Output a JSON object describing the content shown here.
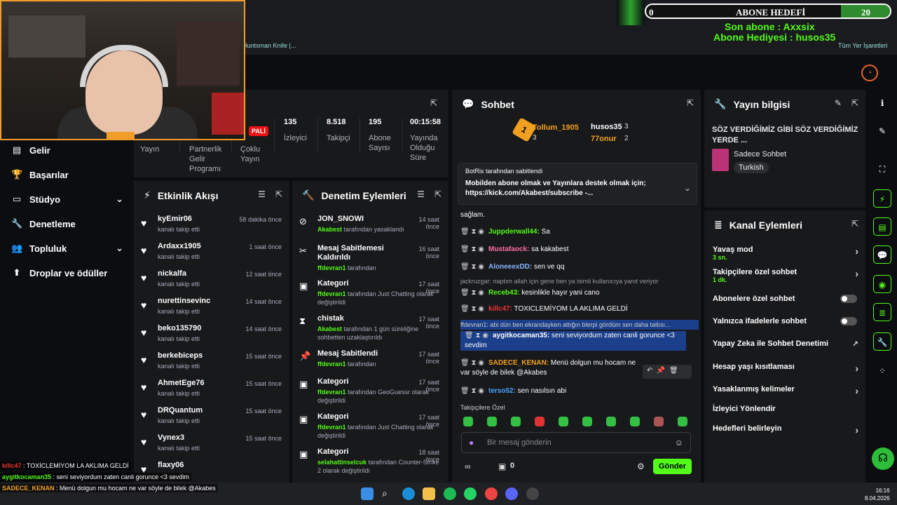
{
  "overlay": {
    "goal_left": "0",
    "goal_title": "ABONE HEDEFİ",
    "goal_value": "20",
    "last_sub": "Son abone : Axxsix",
    "gifter": "Abone Hediyesi : husos35"
  },
  "browser": {
    "bookmark_left": "Huntsman Knife |...",
    "bookmark_right": "Tüm Yer İşaretleri"
  },
  "sidebar": {
    "items": [
      {
        "label": "Gelir"
      },
      {
        "label": "Başarılar"
      },
      {
        "label": "Stüdyo"
      },
      {
        "label": "Denetleme"
      },
      {
        "label": "Topluluk"
      },
      {
        "label": "Droplar ve ödüller"
      }
    ]
  },
  "stats": {
    "badge": "PALİ",
    "cols": [
      {
        "value": "",
        "label": "Yayın"
      },
      {
        "value": "",
        "label": "Partnerlik Gelir Programı"
      },
      {
        "value": "",
        "label": "Çoklu Yayın"
      },
      {
        "value": "135",
        "label": "İzleyici"
      },
      {
        "value": "8.518",
        "label": "Takipçi"
      },
      {
        "value": "195",
        "label": "Abone Sayısı"
      },
      {
        "value": "00:15:58",
        "label": "Yayında Olduğu Süre"
      }
    ]
  },
  "activity": {
    "title": "Etkinlik Akışı",
    "items": [
      {
        "name": "kyEmir06",
        "sub": "kanalı takip etti",
        "time": "58 dakika önce"
      },
      {
        "name": "Ardaxx1905",
        "sub": "kanalı takip etti",
        "time": "1 saat önce"
      },
      {
        "name": "nickalfa",
        "sub": "kanalı takip etti",
        "time": "12 saat önce"
      },
      {
        "name": "nurettinsevinc",
        "sub": "kanalı takip etti",
        "time": "14 saat önce"
      },
      {
        "name": "beko135790",
        "sub": "kanalı takip etti",
        "time": "14 saat önce"
      },
      {
        "name": "berkebiceps",
        "sub": "kanalı takip etti",
        "time": "15 saat önce"
      },
      {
        "name": "AhmetEge76",
        "sub": "kanalı takip etti",
        "time": "15 saat önce"
      },
      {
        "name": "DRQuantum",
        "sub": "kanalı takip etti",
        "time": "15 saat önce"
      },
      {
        "name": "Vynex3",
        "sub": "kanalı takip etti",
        "time": "15 saat önce"
      },
      {
        "name": "flaxy06",
        "sub": "",
        "time": ""
      }
    ]
  },
  "moderation": {
    "title": "Denetim Eylemleri",
    "items": [
      {
        "title": "JON_SNOWI",
        "time": "14 saat önce",
        "actor": "Akabest",
        "desc": " tarafından yasaklandı"
      },
      {
        "title": "Mesaj Sabitlemesi Kaldırıldı",
        "time": "16 saat önce",
        "actor": "ffdevran1",
        "desc": " tarafından"
      },
      {
        "title": "Kategori",
        "time": "17 saat önce",
        "actor": "ffdevran1",
        "desc": " tarafından Just Chatting olarak değiştirildi"
      },
      {
        "title": "chistak",
        "time": "17 saat önce",
        "actor": "Akabest",
        "desc": " tarafından 1 gün süreliğine sohbetten uzaklaştırıldı"
      },
      {
        "title": "Mesaj Sabitlendi",
        "time": "17 saat önce",
        "actor": "ffdevran1",
        "desc": " tarafından"
      },
      {
        "title": "Kategori",
        "time": "17 saat önce",
        "actor": "ffdevran1",
        "desc": " tarafından GeoGuessr olarak değiştirildi"
      },
      {
        "title": "Kategori",
        "time": "17 saat önce",
        "actor": "ffdevran1",
        "desc": " tarafından Just Chatting olarak değiştirildi"
      },
      {
        "title": "Kategori",
        "time": "18 saat önce",
        "actor": "selahattinselcuk",
        "desc": " tarafından Counter-Strike 2 olarak değiştirildi"
      }
    ]
  },
  "chat": {
    "title": "Sohbet",
    "leader1": "Tollum_1905",
    "leader1_val": "3",
    "leader2": "husos35",
    "leader2_val": "3",
    "leader3": "77onur",
    "leader3_val": "2",
    "pinned_by": "BotRix tarafından sabitlendi",
    "pinned_text": "Mobilden abone olmak ve Yayınlara destek olmak için; https://kick.com/Akabest/subscribe -...",
    "messages": [
      {
        "user": "",
        "text": "sağlam."
      },
      {
        "user": "Juppderwall44:",
        "text": " Sa"
      },
      {
        "user": "Mustafaock:",
        "text": " sa kakabest"
      },
      {
        "user": "AloneeexDD:",
        "text": " sen ve qq"
      },
      {
        "user": "",
        "text": "jackruzgar: naptım allah için gene ben ya isimli kullanıcıya yanıt veriyor"
      },
      {
        "user": "Receb43:",
        "text": " kesinlikle hayır yani cano"
      },
      {
        "user": "killc47:",
        "text": " TOXICLEMİYOM LA AKLIMA GELDİ"
      },
      {
        "user": "",
        "text": "ffdevran1: abi dün ben ekrandayken attığın blerpi gördüm sen daha tatlısı..."
      },
      {
        "user": "aygitkocaman35:",
        "text": " seni seviyordum zaten canli gorunce <3 sevdim"
      },
      {
        "user": "SADECE_KENAN:",
        "text": " Menü dolgun mu hocam ne var söyle de bilek @Akabes"
      },
      {
        "user": "terso52:",
        "text": " sen nasılsın abi"
      }
    ],
    "followers_only": "Takipçilere Özel",
    "placeholder": "Bir mesaj gönderin",
    "bottom_count": "0",
    "send": "Gönder"
  },
  "stream_info": {
    "title": "Yayın bilgisi",
    "stream_title": "SÖZ VERDİĞİMİZ GİBİ SÖZ VERDİĞİMİZ YERDE ...",
    "category": "Sadece Sohbet",
    "language": "Turkish"
  },
  "channel_actions": {
    "title": "Kanal Eylemleri",
    "rows": [
      {
        "label": "Yavaş mod",
        "sub": "3 sn."
      },
      {
        "label": "Takipçilere özel sohbet",
        "sub": "1 dk."
      },
      {
        "label": "Abonelere özel sohbet",
        "sub": ""
      },
      {
        "label": "Yalnızca ifadelerle sohbet",
        "sub": ""
      },
      {
        "label": "Yapay Zeka ile Sohbet Denetimi",
        "sub": ""
      },
      {
        "label": "Hesap yaşı kısıtlaması",
        "sub": ""
      },
      {
        "label": "Yasaklanmış kelimeler",
        "sub": ""
      },
      {
        "label": "İzleyici Yönlendir",
        "sub": ""
      },
      {
        "label": "Hedefleri belirleyin",
        "sub": ""
      }
    ]
  },
  "overlay_chat": [
    {
      "user": "killc47",
      "text": " : TOXİCLEMİYOM LA AKLIMA GELDİ"
    },
    {
      "user": "aygitkocaman35",
      "text": " : seni seviyordum zaten canli gorunce <3 sevdim"
    },
    {
      "user": "SADECE_KENAN",
      "text": " : Menü dolgun mu hocam ne var söyle de bilek @Akabes"
    }
  ],
  "taskbar": {
    "time": "16:16",
    "date": "8.04.2026"
  },
  "colors": {
    "accent": "#53fc18",
    "panel": "#18191b",
    "bg": "#0b0d10",
    "webcam_border": "#f29d2a"
  }
}
